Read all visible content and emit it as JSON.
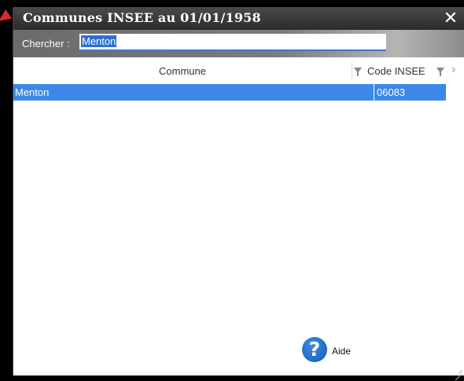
{
  "window": {
    "title": "Communes INSEE au 01/01/1958",
    "close_glyph": "✕"
  },
  "search": {
    "label": "Chercher :",
    "value": "Menton"
  },
  "table": {
    "columns": [
      "Commune",
      "Code INSEE"
    ],
    "rows": [
      {
        "commune": "Menton",
        "code": "06083"
      }
    ]
  },
  "footer": {
    "help_label": "Aide",
    "help_glyph": "?"
  },
  "colors": {
    "accent": "#3b88e8",
    "titlebar": "#333333",
    "help": "#1f6fcc"
  }
}
